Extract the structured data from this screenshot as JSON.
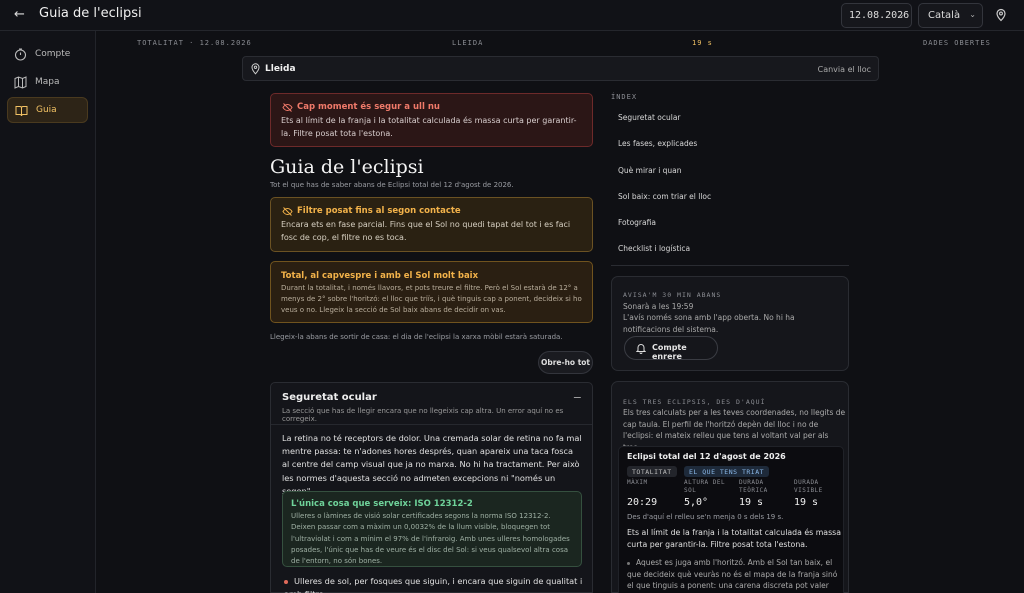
{
  "header": {
    "back_label": "←",
    "title": "Guia de l'eclipsi",
    "date_value": "12.08.2026",
    "language_value": "Català"
  },
  "sidebar": {
    "items": [
      {
        "label": "Compte",
        "icon": "timer-icon"
      },
      {
        "label": "Mapa",
        "icon": "map-icon"
      },
      {
        "label": "Guia",
        "icon": "book-icon",
        "active": true
      }
    ]
  },
  "strip": {
    "left": "TOTALITAT · 12.08.2026",
    "place": "LLEIDA",
    "duration": "19 s",
    "right": "DADES OBERTES"
  },
  "location": {
    "name": "Lleida",
    "change_label": "Canvia el lloc"
  },
  "alerts": {
    "red": {
      "title": "Cap moment és segur a ull nu",
      "text": "Ets al límit de la franja i la totalitat calculada és massa curta per garantir-la. Filtre posat tota l'estona."
    },
    "amber": {
      "title": "Filtre posat fins al segon contacte",
      "text": "Encara ets en fase parcial. Fins que el Sol no quedi tapat del tot i es faci fosc de cop, el filtre no es toca."
    },
    "dusk": {
      "title": "Total, al capvespre i amb el Sol molt baix",
      "text": "Durant la totalitat, i només llavors, et pots treure el filtre. Però el Sol estarà de 12° a menys de 2° sobre l'horitzó: el lloc que triïs, i què tinguis cap a ponent, decideix si ho veus o no. Llegeix la secció de Sol baix abans de decidir on vas."
    }
  },
  "main": {
    "title": "Guia de l'eclipsi",
    "subtitle": "Tot el que has de saber abans de Eclipsi total del 12 d'agost de 2026.",
    "note": "Llegeix-la abans de sortir de casa: el dia de l'eclipsi la xarxa mòbil estarà saturada.",
    "open_all": "Obre-ho tot"
  },
  "section": {
    "title": "Seguretat ocular",
    "subtitle": "La secció que has de llegir encara que no llegeixis cap altra. Un error aquí no es corregeix.",
    "collapse": "−",
    "body": "La retina no té receptors de dolor. Una cremada solar de retina no fa mal mentre passa: te n'adones hores després, quan apareix una taca fosca al centre del camp visual que ja no marxa. No hi ha tractament. Per això les normes d'aquesta secció no admeten excepcions ni \"només un segon\".",
    "iso_title": "L'única cosa que serveix: ISO 12312-2",
    "iso_text": "Ulleres o làmines de visió solar certificades segons la norma ISO 12312-2. Deixen passar com a màxim un 0,0032% de la llum visible, bloquegen tot l'ultraviolat i com a mínim el 97% de l'infraroig. Amb unes ulleres homologades posades, l'únic que has de veure és el disc del Sol: si veus qualsevol altra cosa de l'entorn, no són bones.",
    "bullet": "Ulleres de sol, per fosques que siguin, i encara que siguin de qualitat i amb filtre"
  },
  "index": {
    "label": "ÍNDEX",
    "items": [
      "Seguretat ocular",
      "Les fases, explicades",
      "Què mirar i quan",
      "Sol baix: com triar el lloc",
      "Fotografia",
      "Checklist i logística"
    ]
  },
  "reminder": {
    "label": "AVISA'M 30 MIN ABANS",
    "time": "Sonarà a les 19:59",
    "text": "L'avís només sona amb l'app oberta. No hi ha notificacions del sistema.",
    "button": "Compte enrere"
  },
  "eclipses": {
    "label": "ELS TRES ECLIPSIS, DES D'AQUÍ",
    "text": "Els tres calculats per a les teves coordenades, no llegits de cap taula. El perfil de l'horitzó depèn del lloc i no de l'eclipsi: el mateix relleu que tens al voltant val per als tres.",
    "card": {
      "title": "Eclipsi total del 12 d'agost de 2026",
      "pill1": "TOTALITAT",
      "pill2": "EL QUE TENS TRIAT",
      "stats": [
        {
          "label": "MÀXIM",
          "value": "20:29"
        },
        {
          "label": "ALTURA DEL SOL",
          "value": "5,0°"
        },
        {
          "label": "DURADA TEÒRICA",
          "value": "19 s"
        },
        {
          "label": "DURADA VISIBLE",
          "value": "19 s"
        }
      ],
      "detail": "Des d'aquí el relleu se'n menja 0 s dels 19 s.",
      "warn": "Ets al límit de la franja i la totalitat calculada és massa curta per garantir-la. Filtre posat tota l'estona.",
      "point": "Aquest es juga amb l'horitzó. Amb el Sol tan baix, el que decideix què veuràs no és el mapa de la franja sinó el que tinguis a ponent: una carena discreta pot valer més que"
    }
  },
  "colors": {
    "accent": "#f2c264",
    "danger": "#f07a6a",
    "warning": "#f2b24a",
    "success": "#6fd39a",
    "info": "#8ab8e8"
  }
}
